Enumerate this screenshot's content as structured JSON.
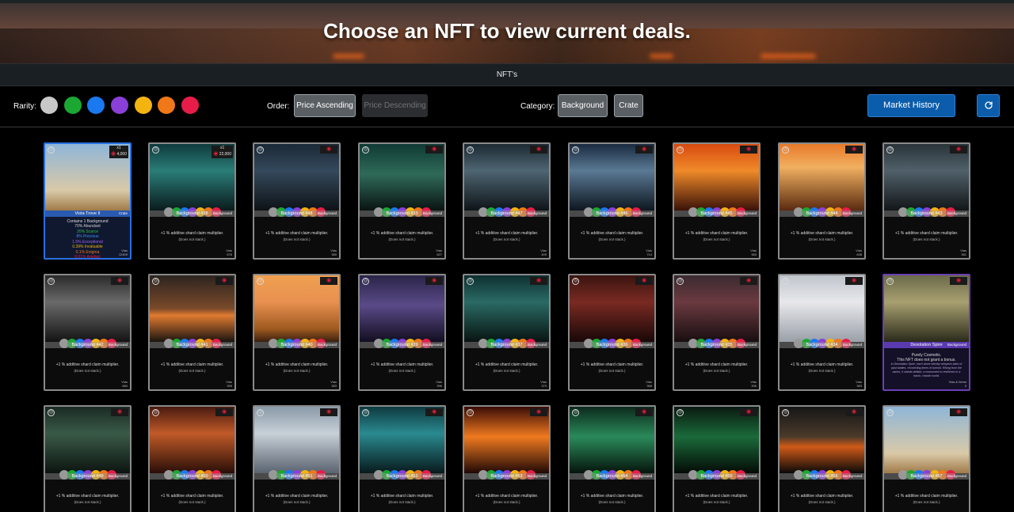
{
  "header": {
    "title": "Choose an NFT to view current deals."
  },
  "tabs": {
    "active": "NFT's"
  },
  "filters": {
    "rarity_label": "Rarity:",
    "rarity_colors": [
      "#c8c8c8",
      "#1aa832",
      "#1a78f0",
      "#8a3fd8",
      "#f4b410",
      "#f07818",
      "#e81c48"
    ],
    "order_label": "Order:",
    "price_ascending": "Price Ascending",
    "price_descending": "Price Descending",
    "category_label": "Category:",
    "category_background": "Background",
    "category_crate": "Crate",
    "market_history": "Market History",
    "refresh_icon": "refresh-icon"
  },
  "rarity_dot_colors": [
    "#9a9a9a",
    "#1aa832",
    "#1a78f0",
    "#8a3fd8",
    "#f4b410",
    "#f07818",
    "#e81c48"
  ],
  "featured_card": {
    "name": "Vista Trove II",
    "category": "Crate",
    "corner_count": "x1",
    "corner_price": "4,000",
    "contains": "Contains 1 Background",
    "odds": [
      {
        "text": "70% Abundant",
        "color": "#cfcfcf"
      },
      {
        "text": "20% Scarce",
        "color": "#2fbf4a"
      },
      {
        "text": "8% Precious",
        "color": "#3a8cff"
      },
      {
        "text": "1.5% Exceptional",
        "color": "#a060f0"
      },
      {
        "text": "0.39% Invaluable",
        "color": "#f4b410"
      },
      {
        "text": "0.1% Enigma",
        "color": "#f07818"
      },
      {
        "text": "0.01% Artefact",
        "color": "#e81c48"
      }
    ],
    "foot_label": "Vias",
    "foot_value": "12409"
  },
  "cosmetic_card": {
    "name": "Desolation Spire",
    "category": "Background",
    "line1": "Purely Cosmetic.",
    "line2": "This NFT does not grant a bonus.",
    "lore": "in Desolation Spire, each stone silently whispers tales of past battles, chronicling times of turmoil. Rising from the ashes, it stands defiant, a monument to resilience in a harsh, chaotic world.",
    "foot_label": "Vias & Items",
    "foot_value": "3"
  },
  "card_common": {
    "bonus": "+1 % additive shard claim multiplier.",
    "stack": "(Does not stack.)",
    "category": "Background",
    "foot_label": "Vias",
    "second_count": "x1",
    "second_price": "22,000"
  },
  "cards": [
    {
      "name": "Background #38",
      "foot": "678"
    },
    {
      "name": "Background #48",
      "foot": "380"
    },
    {
      "name": "Background #33",
      "foot": "627"
    },
    {
      "name": "Background #47",
      "foot": "409"
    },
    {
      "name": "Background #46",
      "foot": "714"
    },
    {
      "name": "Background #45",
      "foot": "383"
    },
    {
      "name": "Background #44",
      "foot": "638"
    },
    {
      "name": "Background #43",
      "foot": "381"
    },
    {
      "name": "Background #42",
      "foot": "684"
    },
    {
      "name": "Background #41",
      "foot": "396"
    },
    {
      "name": "Background #40",
      "foot": "383"
    },
    {
      "name": "Background #39",
      "foot": "396"
    },
    {
      "name": "Background #37",
      "foot": "379"
    },
    {
      "name": "Background #36",
      "foot": "368"
    },
    {
      "name": "Background #35",
      "foot": "396"
    },
    {
      "name": "Background #34",
      "foot": "383"
    },
    {
      "name": "Background #49",
      "foot": ""
    },
    {
      "name": "Background #50",
      "foot": ""
    },
    {
      "name": "Background #51",
      "foot": ""
    },
    {
      "name": "Background #52",
      "foot": ""
    },
    {
      "name": "Background #53",
      "foot": ""
    },
    {
      "name": "Background #54",
      "foot": ""
    },
    {
      "name": "Background #55",
      "foot": ""
    },
    {
      "name": "Background #56",
      "foot": ""
    },
    {
      "name": "Background #57",
      "foot": ""
    }
  ]
}
